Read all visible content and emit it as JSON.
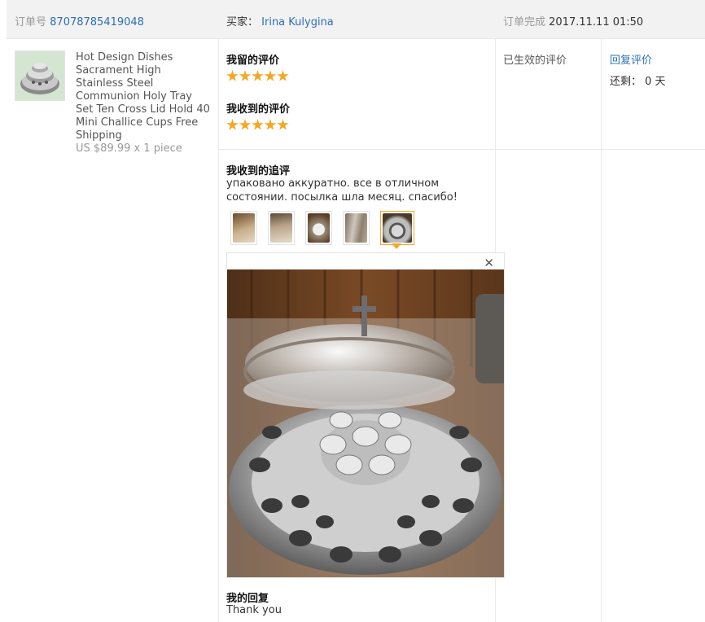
{
  "order": {
    "number_label": "订单号",
    "number": "87078785419048",
    "buyer_label": "买家：",
    "buyer_name": "Irina Kulygina",
    "status_label": "订单完成",
    "completed_at": "2017.11.11 01:50"
  },
  "product": {
    "title": "Hot Design Dishes Sacrament High Stainless Steel Communion Holy Tray Set Ten Cross Lid Hold 40 Mini Challice Cups Free Shipping",
    "price": "US $89.99 x 1 piece",
    "thumb_icon": "communion-tray-thumbnail"
  },
  "feedback": {
    "my_review_label": "我留的评价",
    "my_review_stars": 5,
    "received_review_label": "我收到的评价",
    "received_review_stars": 5,
    "followup_label": "我收到的追评",
    "followup_text": "упаковано аккуратно. все в отличном состоянии. посылка шла месяц. спасибо!",
    "photo_count": 5,
    "active_photo_index": 4,
    "close_icon": "close-icon",
    "reply_label": "我的回复",
    "reply_text": "Thank you"
  },
  "status": {
    "effective_label": "已生效的评价"
  },
  "actions": {
    "reply_link": "回复评价",
    "remaining_label": "还剩：",
    "remaining_value": "0 天"
  },
  "colors": {
    "accent": "#f5a623",
    "link": "#2a6fb7"
  }
}
